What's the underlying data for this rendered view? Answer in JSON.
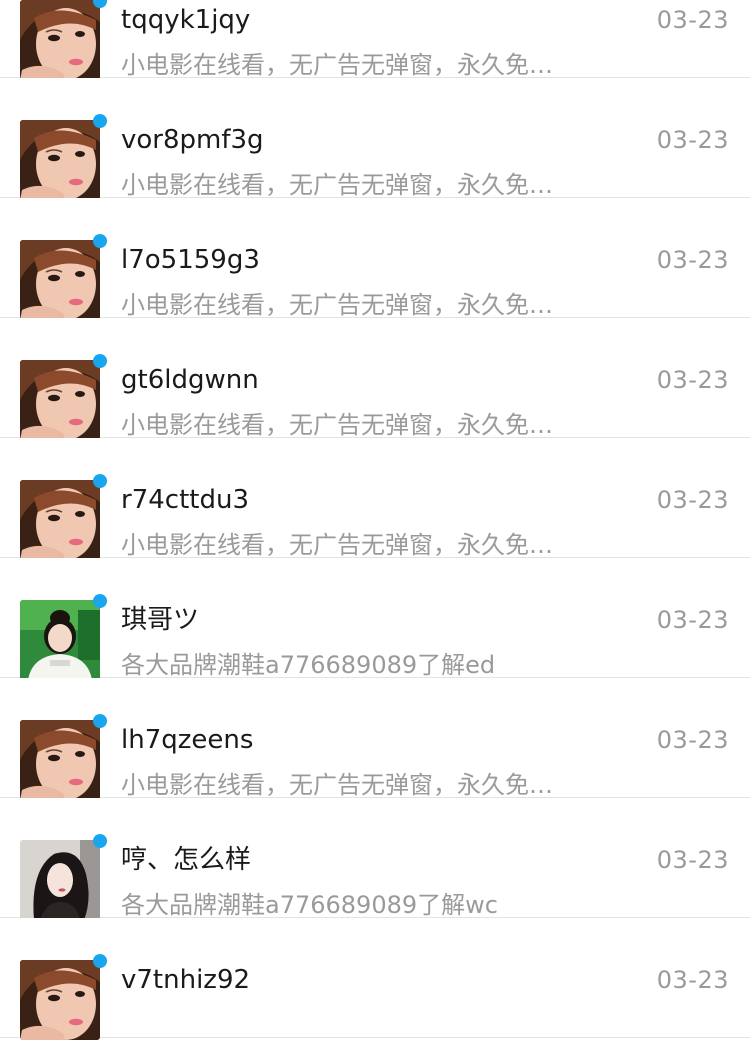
{
  "conversations": [
    {
      "name": "tqqyk1jqy",
      "message": "小电影在线看，无广告无弹窗，永久免…",
      "date": "03-23",
      "avatar": "girl-a",
      "unread": true
    },
    {
      "name": "vor8pmf3g",
      "message": "小电影在线看，无广告无弹窗，永久免…",
      "date": "03-23",
      "avatar": "girl-a",
      "unread": true
    },
    {
      "name": "l7o5159g3",
      "message": "小电影在线看，无广告无弹窗，永久免…",
      "date": "03-23",
      "avatar": "girl-a",
      "unread": true
    },
    {
      "name": "gt6ldgwnn",
      "message": "小电影在线看，无广告无弹窗，永久免…",
      "date": "03-23",
      "avatar": "girl-a",
      "unread": true
    },
    {
      "name": "r74cttdu3",
      "message": "小电影在线看，无广告无弹窗，永久免…",
      "date": "03-23",
      "avatar": "girl-a",
      "unread": true
    },
    {
      "name": "琪哥ツ",
      "message": "各大品牌潮鞋a776689089了解ed",
      "date": "03-23",
      "avatar": "girl-b",
      "unread": true
    },
    {
      "name": "lh7qzeens",
      "message": "小电影在线看，无广告无弹窗，永久免…",
      "date": "03-23",
      "avatar": "girl-a",
      "unread": true
    },
    {
      "name": "哼、怎么样",
      "message": "各大品牌潮鞋a776689089了解wc",
      "date": "03-23",
      "avatar": "girl-c",
      "unread": true
    },
    {
      "name": "v7tnhiz92",
      "message": "",
      "date": "03-23",
      "avatar": "girl-a",
      "unread": true
    }
  ],
  "colors": {
    "unread_dot": "#1aa6ee",
    "name_text": "#1a1a1a",
    "secondary_text": "#9a9a9a",
    "divider": "#e3e3e3"
  }
}
